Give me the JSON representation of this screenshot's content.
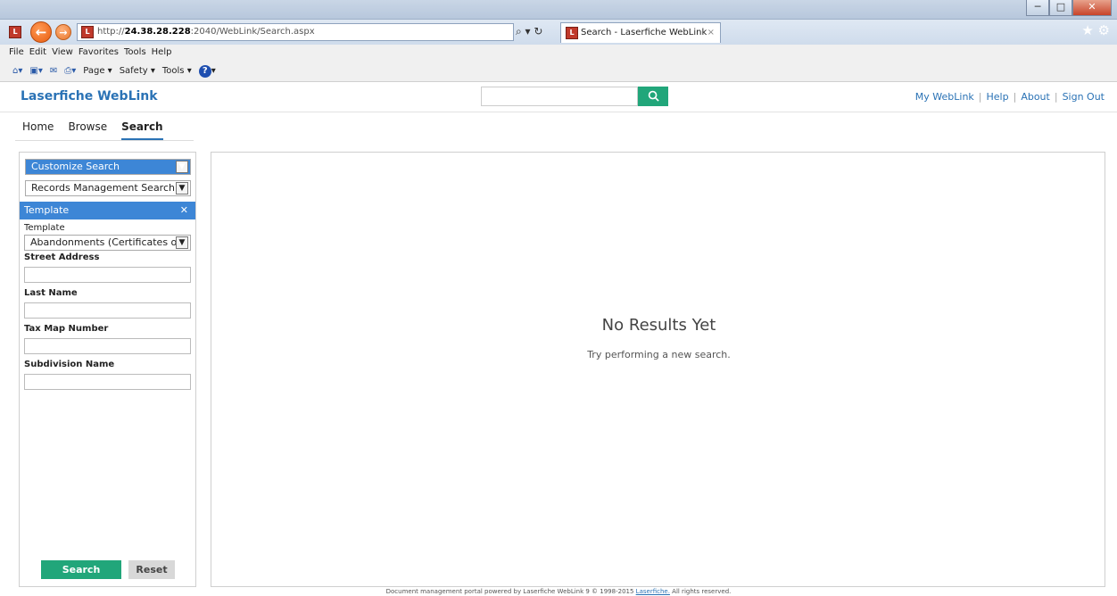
{
  "browser": {
    "window_title": "Search - Laserfiche WebLink",
    "address": {
      "prefix": "http://",
      "host": "24.38.28.228",
      "rest": ":2040/WebLink/Search.aspx"
    },
    "tab_title": "Search - Laserfiche WebLink",
    "menu": [
      "File",
      "Edit",
      "View",
      "Favorites",
      "Tools",
      "Help"
    ],
    "commands": {
      "page": "Page ▾",
      "safety": "Safety ▾",
      "tools": "Tools ▾"
    }
  },
  "app": {
    "logo": "Laserfiche WebLink",
    "search": {
      "placeholder": ""
    },
    "toplinks": {
      "my_weblink": "My WebLink",
      "help": "Help",
      "about": "About",
      "sign_out": "Sign Out",
      "separator": "|"
    }
  },
  "subnav": {
    "home": "Home",
    "browse": "Browse",
    "search": "Search"
  },
  "left_panel": {
    "customize_select": "Customize Search",
    "search_type_select": "Records Management Search",
    "template_header": "Template",
    "template_label": "Template",
    "template_select": "Abandonments (Certificates of)",
    "fields": [
      {
        "label": "Street Address",
        "value": ""
      },
      {
        "label": "Last Name",
        "value": ""
      },
      {
        "label": "Tax Map Number",
        "value": ""
      },
      {
        "label": "Subdivision Name",
        "value": ""
      }
    ],
    "search_button": "Search",
    "reset_button": "Reset"
  },
  "results": {
    "heading": "No Results Yet",
    "message": "Try performing a new search."
  },
  "footer": {
    "text": "Document management portal powered by Laserfiche WebLink 9 © 1998-2015",
    "link": "Laserfiche.",
    "suffix": "All rights reserved."
  },
  "colors": {
    "accent": "#2a72b5",
    "green": "#21a67a",
    "selection": "#3d86d6"
  }
}
